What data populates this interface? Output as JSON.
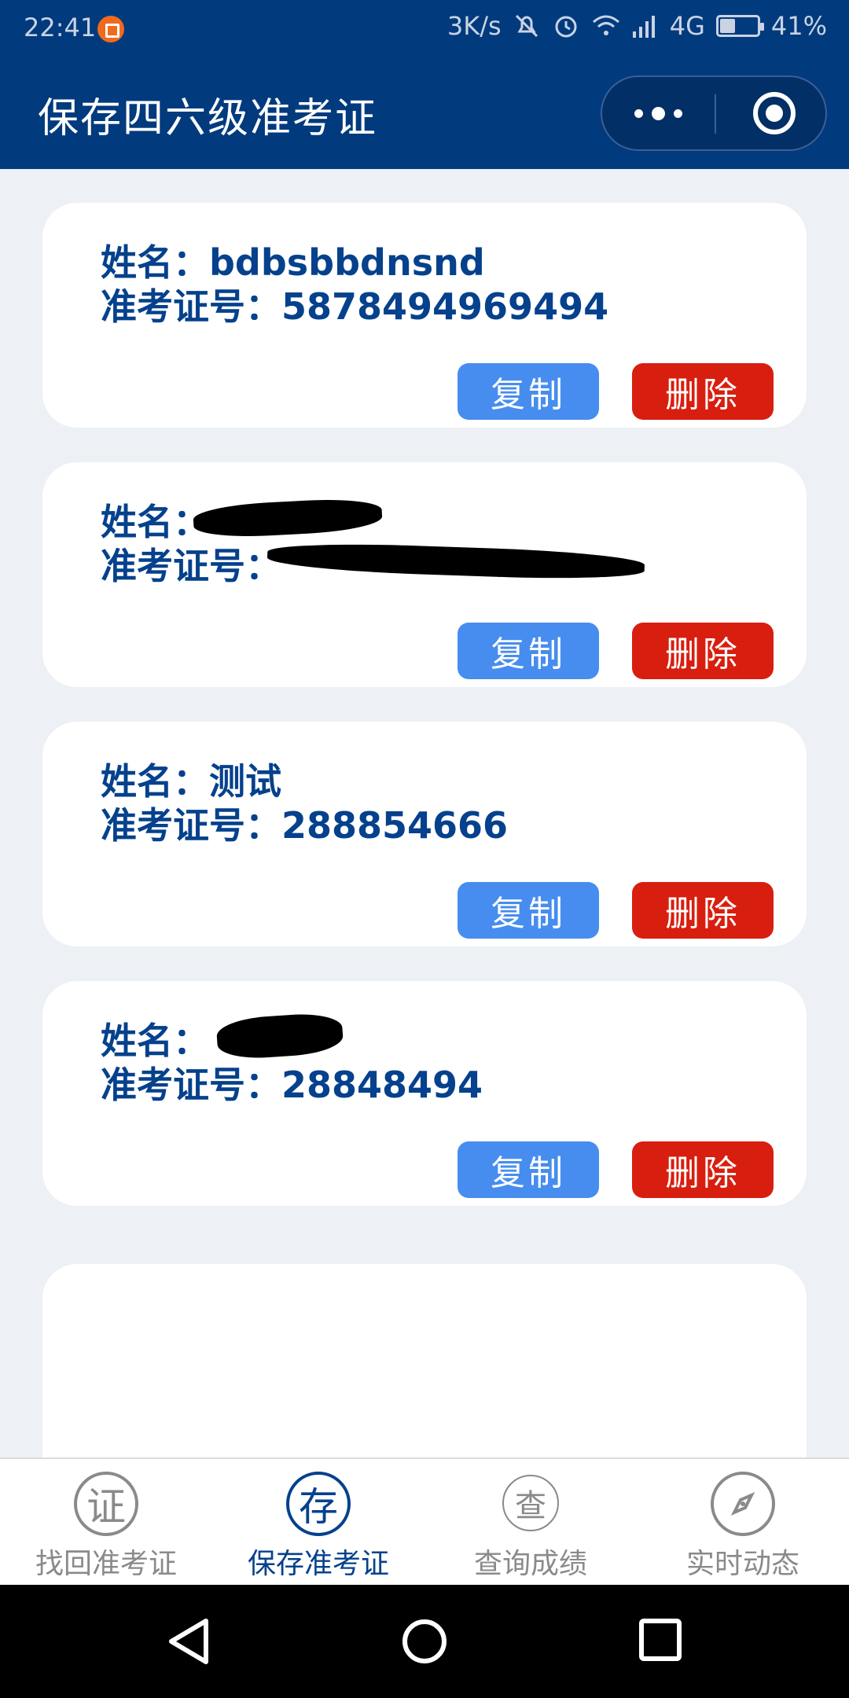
{
  "status": {
    "time": "22:41",
    "speed": "3K/s",
    "network": "4G",
    "battery": "41%",
    "battery_level": 0.41,
    "icons": [
      "notification-app-icon",
      "bell-muted-icon",
      "alarm-icon",
      "wifi-icon",
      "signal-icon",
      "battery-icon"
    ]
  },
  "header": {
    "title": "保存四六级准考证",
    "menu_icon": "more-dots-icon",
    "close_icon": "target-close-icon"
  },
  "cards": [
    {
      "name_label": "姓名：",
      "name": "bdbsbbdnsnd",
      "ticket_label": "准考证号：",
      "ticket": "5878494969494",
      "copy_label": "复制",
      "delete_label": "删除"
    },
    {
      "name_label": "姓名：",
      "name": "",
      "ticket_label": "准考证号：",
      "ticket": "",
      "copy_label": "复制",
      "delete_label": "删除"
    },
    {
      "name_label": "姓名：",
      "name": "测试",
      "ticket_label": "准考证号：",
      "ticket": "288854666",
      "copy_label": "复制",
      "delete_label": "删除"
    },
    {
      "name_label": "姓名：",
      "name": "",
      "ticket_label": "准考证号：",
      "ticket": "28848494",
      "copy_label": "复制",
      "delete_label": "删除"
    }
  ],
  "tabs": [
    {
      "label": "找回准考证",
      "icon_glyph": "证",
      "icon": "certificate-icon",
      "active": false
    },
    {
      "label": "保存准考证",
      "icon_glyph": "存",
      "icon": "save-icon",
      "active": true
    },
    {
      "label": "查询成绩",
      "icon_glyph": "查",
      "icon": "search-score-icon",
      "active": false
    },
    {
      "label": "实时动态",
      "icon_glyph": "",
      "icon": "compass-icon",
      "active": false
    }
  ],
  "colors": {
    "header_bg": "#023a7e",
    "text_primary": "#05418c",
    "copy_button": "#478def",
    "delete_button": "#d81e0f",
    "page_bg": "#edf0f5"
  }
}
